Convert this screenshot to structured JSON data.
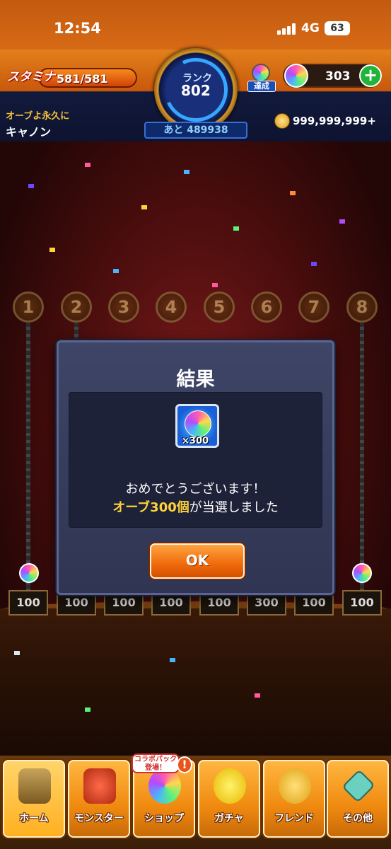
{
  "status_bar": {
    "time": "12:54",
    "network": "4G",
    "battery": "63"
  },
  "header": {
    "stamina_label": "スタミナ",
    "stamina_value": "581/581",
    "rank_label": "ランク",
    "rank_value": "802",
    "rank_next_prefix": "あと",
    "rank_next_value": "489938",
    "achievement_label": "達成",
    "orb_count": "303",
    "player_subtitle": "オーブよ永久に",
    "player_name": "キャノン",
    "coin_value": "999,999,999+"
  },
  "stage": {
    "slots": [
      "1",
      "2",
      "3",
      "4",
      "5",
      "6",
      "7",
      "8"
    ],
    "prizes": [
      "100",
      "100",
      "100",
      "100",
      "100",
      "300",
      "100",
      "100"
    ]
  },
  "dialog": {
    "title": "結果",
    "reward_qty": "×300",
    "message_line1": "おめでとうございます！",
    "message_highlight": "オーブ300個",
    "message_rest": "が当選しました",
    "ok_label": "OK"
  },
  "nav": {
    "items": [
      {
        "label": "ホーム"
      },
      {
        "label": "モンスター"
      },
      {
        "label": "ショップ"
      },
      {
        "label": "ガチャ"
      },
      {
        "label": "フレンド"
      },
      {
        "label": "その他"
      }
    ],
    "shop_badge": "コラボパック登場！",
    "shop_alert": "!"
  }
}
